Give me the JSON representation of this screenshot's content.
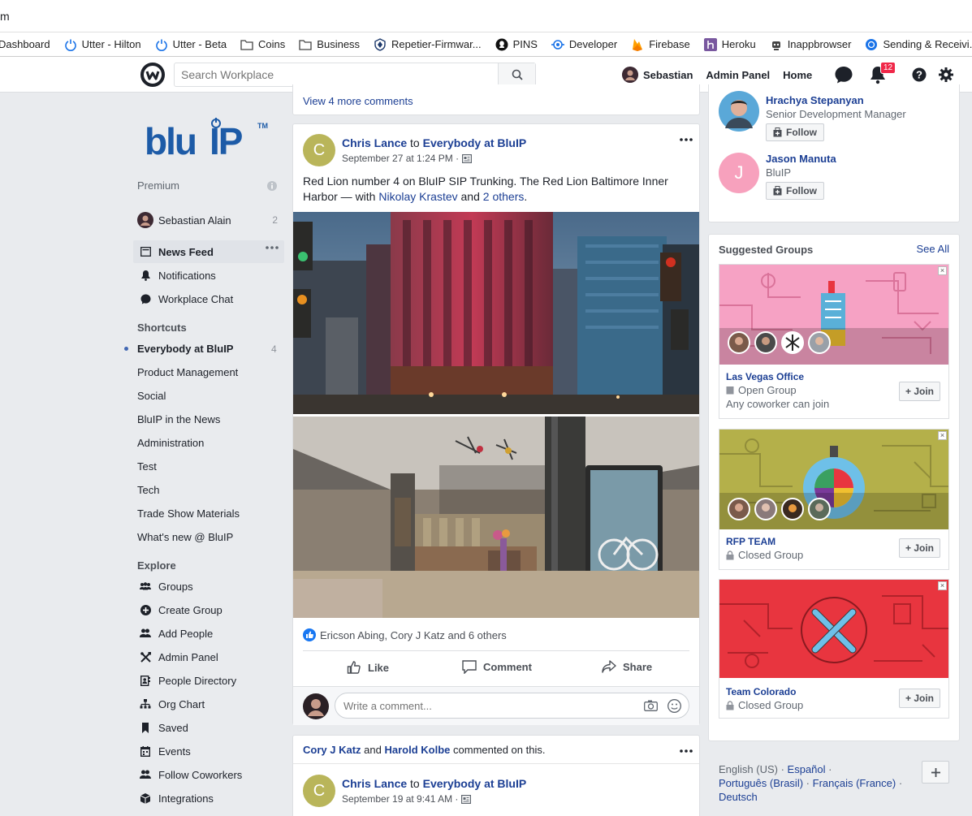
{
  "browser": {
    "url_fragment": "m",
    "bookmarks": [
      {
        "label": "Dashboard",
        "icon": "none"
      },
      {
        "label": "Utter - Hilton",
        "icon": "power-icon"
      },
      {
        "label": "Utter - Beta",
        "icon": "power-icon"
      },
      {
        "label": "Coins",
        "icon": "folder-icon"
      },
      {
        "label": "Business",
        "icon": "folder-icon"
      },
      {
        "label": "Repetier-Firmwar...",
        "icon": "shield-icon"
      },
      {
        "label": "PINS",
        "icon": "github-icon"
      },
      {
        "label": "Developer",
        "icon": "developer-icon"
      },
      {
        "label": "Firebase",
        "icon": "firebase-icon"
      },
      {
        "label": "Heroku",
        "icon": "heroku-icon"
      },
      {
        "label": "Inappbrowser",
        "icon": "robot-icon"
      },
      {
        "label": "Sending & Receivi...",
        "icon": "globe-icon"
      }
    ]
  },
  "topnav": {
    "search_placeholder": "Search Workplace",
    "user_name": "Sebastian",
    "admin_panel": "Admin Panel",
    "home": "Home",
    "notification_count": "12"
  },
  "sidebar": {
    "premium_label": "Premium",
    "user": {
      "name": "Sebastian Alain",
      "count": "2"
    },
    "main_items": [
      {
        "label": "News Feed",
        "icon": "newsfeed-icon"
      },
      {
        "label": "Notifications",
        "icon": "bell-icon"
      },
      {
        "label": "Workplace Chat",
        "icon": "chat-icon"
      }
    ],
    "shortcuts_header": "Shortcuts",
    "shortcuts": [
      {
        "label": "Everybody at BluIP",
        "count": "4"
      },
      {
        "label": "Product Management"
      },
      {
        "label": "Social"
      },
      {
        "label": "BluIP in the News"
      },
      {
        "label": "Administration"
      },
      {
        "label": "Test"
      },
      {
        "label": "Tech"
      },
      {
        "label": "Trade Show Materials"
      },
      {
        "label": "What's new @ BluIP"
      }
    ],
    "explore_header": "Explore",
    "explore": [
      {
        "label": "Groups",
        "icon": "groups-icon"
      },
      {
        "label": "Create Group",
        "icon": "plus-circle-icon"
      },
      {
        "label": "Add People",
        "icon": "add-people-icon"
      },
      {
        "label": "Admin Panel",
        "icon": "tools-icon"
      },
      {
        "label": "People Directory",
        "icon": "directory-icon"
      },
      {
        "label": "Org Chart",
        "icon": "org-chart-icon"
      },
      {
        "label": "Saved",
        "icon": "bookmark-icon"
      },
      {
        "label": "Events",
        "icon": "calendar-icon"
      },
      {
        "label": "Follow Coworkers",
        "icon": "follow-coworkers-icon"
      },
      {
        "label": "Integrations",
        "icon": "cube-icon"
      }
    ]
  },
  "feed": {
    "view_more_comments": "View 4 more comments",
    "post1": {
      "author": "Chris Lance",
      "to_word": "to",
      "group": "Everybody at BluIP",
      "avatar_letter": "C",
      "timestamp": "September 27 at 1:24 PM ·",
      "text_part1": "Red Lion number 4 on BluIP SIP Trunking. The Red Lion Baltimore Inner Harbor — with ",
      "tag_person": "Nikolay Krastev",
      "and_word": " and ",
      "tag_others": "2 others",
      "text_end": ".",
      "reactions": "Ericson Abing, Cory J Katz and 6 others",
      "like": "Like",
      "comment": "Comment",
      "share": "Share",
      "comment_placeholder": "Write a comment..."
    },
    "post2": {
      "commenter1": "Cory J Katz",
      "and_word": "and",
      "commenter2": "Harold Kolbe",
      "commented_text": "commented on this.",
      "author": "Chris Lance",
      "to_word": "to",
      "group": "Everybody at BluIP",
      "avatar_letter": "C",
      "timestamp": "September 19 at 9:41 AM ·"
    }
  },
  "right": {
    "people": [
      {
        "name": "Hrachya Stepanyan",
        "title": "Senior Development Manager",
        "follow": "Follow"
      },
      {
        "name": "Jason Manuta",
        "title": "BluIP",
        "follow": "Follow",
        "avatar_letter": "J"
      }
    ],
    "suggested_title": "Suggested Groups",
    "see_all": "See All",
    "groups": [
      {
        "name": "Las Vegas Office",
        "privacy": "Open Group",
        "note": "Any coworker can join",
        "join": "+ Join",
        "color": "#f6a2c4"
      },
      {
        "name": "RFP TEAM",
        "privacy": "Closed Group",
        "join": "+ Join",
        "color": "#b4b04a"
      },
      {
        "name": "Team Colorado",
        "privacy": "Closed Group",
        "join": "+ Join",
        "color": "#e8353f"
      }
    ],
    "languages": {
      "current": "English (US) ·",
      "espanol": "Español",
      "sep": "·",
      "portugues": "Português (Brasil)",
      "francais": "Français (France)",
      "deutsch": "Deutsch"
    }
  },
  "colors": {
    "link": "#1c3f94",
    "brand_blue": "#1d5ba7",
    "badge": "#f02849"
  }
}
